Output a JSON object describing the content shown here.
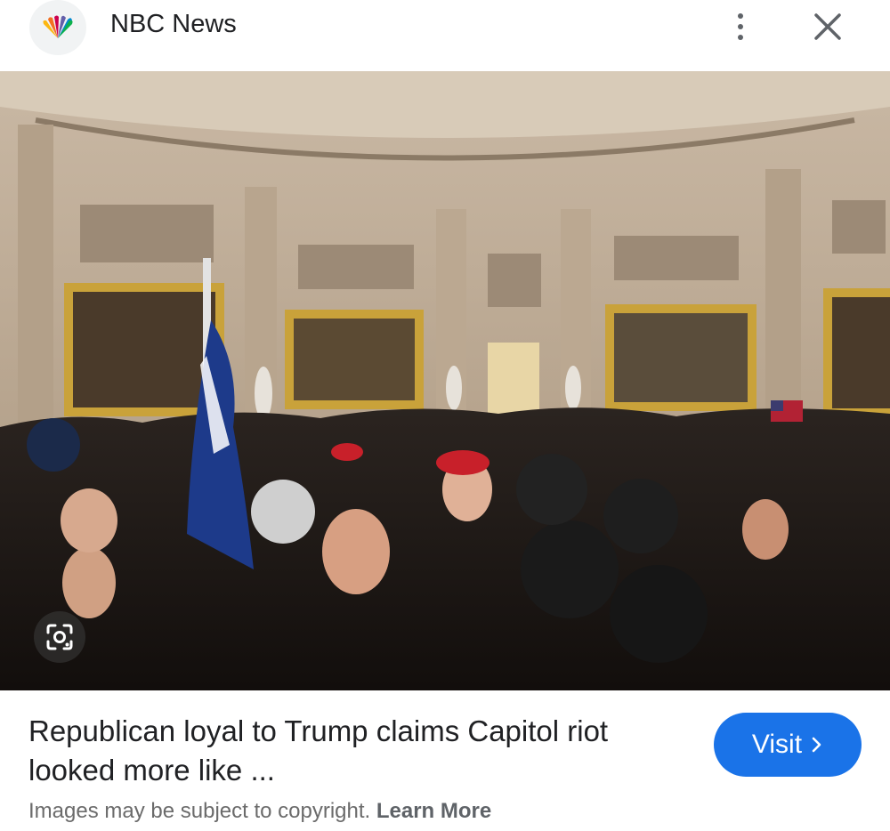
{
  "header": {
    "source_name": "NBC News",
    "logo_icon": "nbc-peacock-icon",
    "more_icon": "more-vert-icon",
    "close_icon": "close-icon"
  },
  "image": {
    "alt": "Crowd in the Capitol Rotunda",
    "lens_icon": "google-lens-icon"
  },
  "result": {
    "title_line1": "Republican loyal to Trump claims Capitol riot",
    "title_line2": "looked more like ...",
    "visit_label": "Visit",
    "visit_icon": "chevron-right-icon"
  },
  "footer": {
    "copyright_text": "Images may be subject to copyright.",
    "learn_more": "Learn More"
  },
  "colors": {
    "accent": "#1a73e8",
    "text": "#202124",
    "muted": "#6b6b6b"
  }
}
